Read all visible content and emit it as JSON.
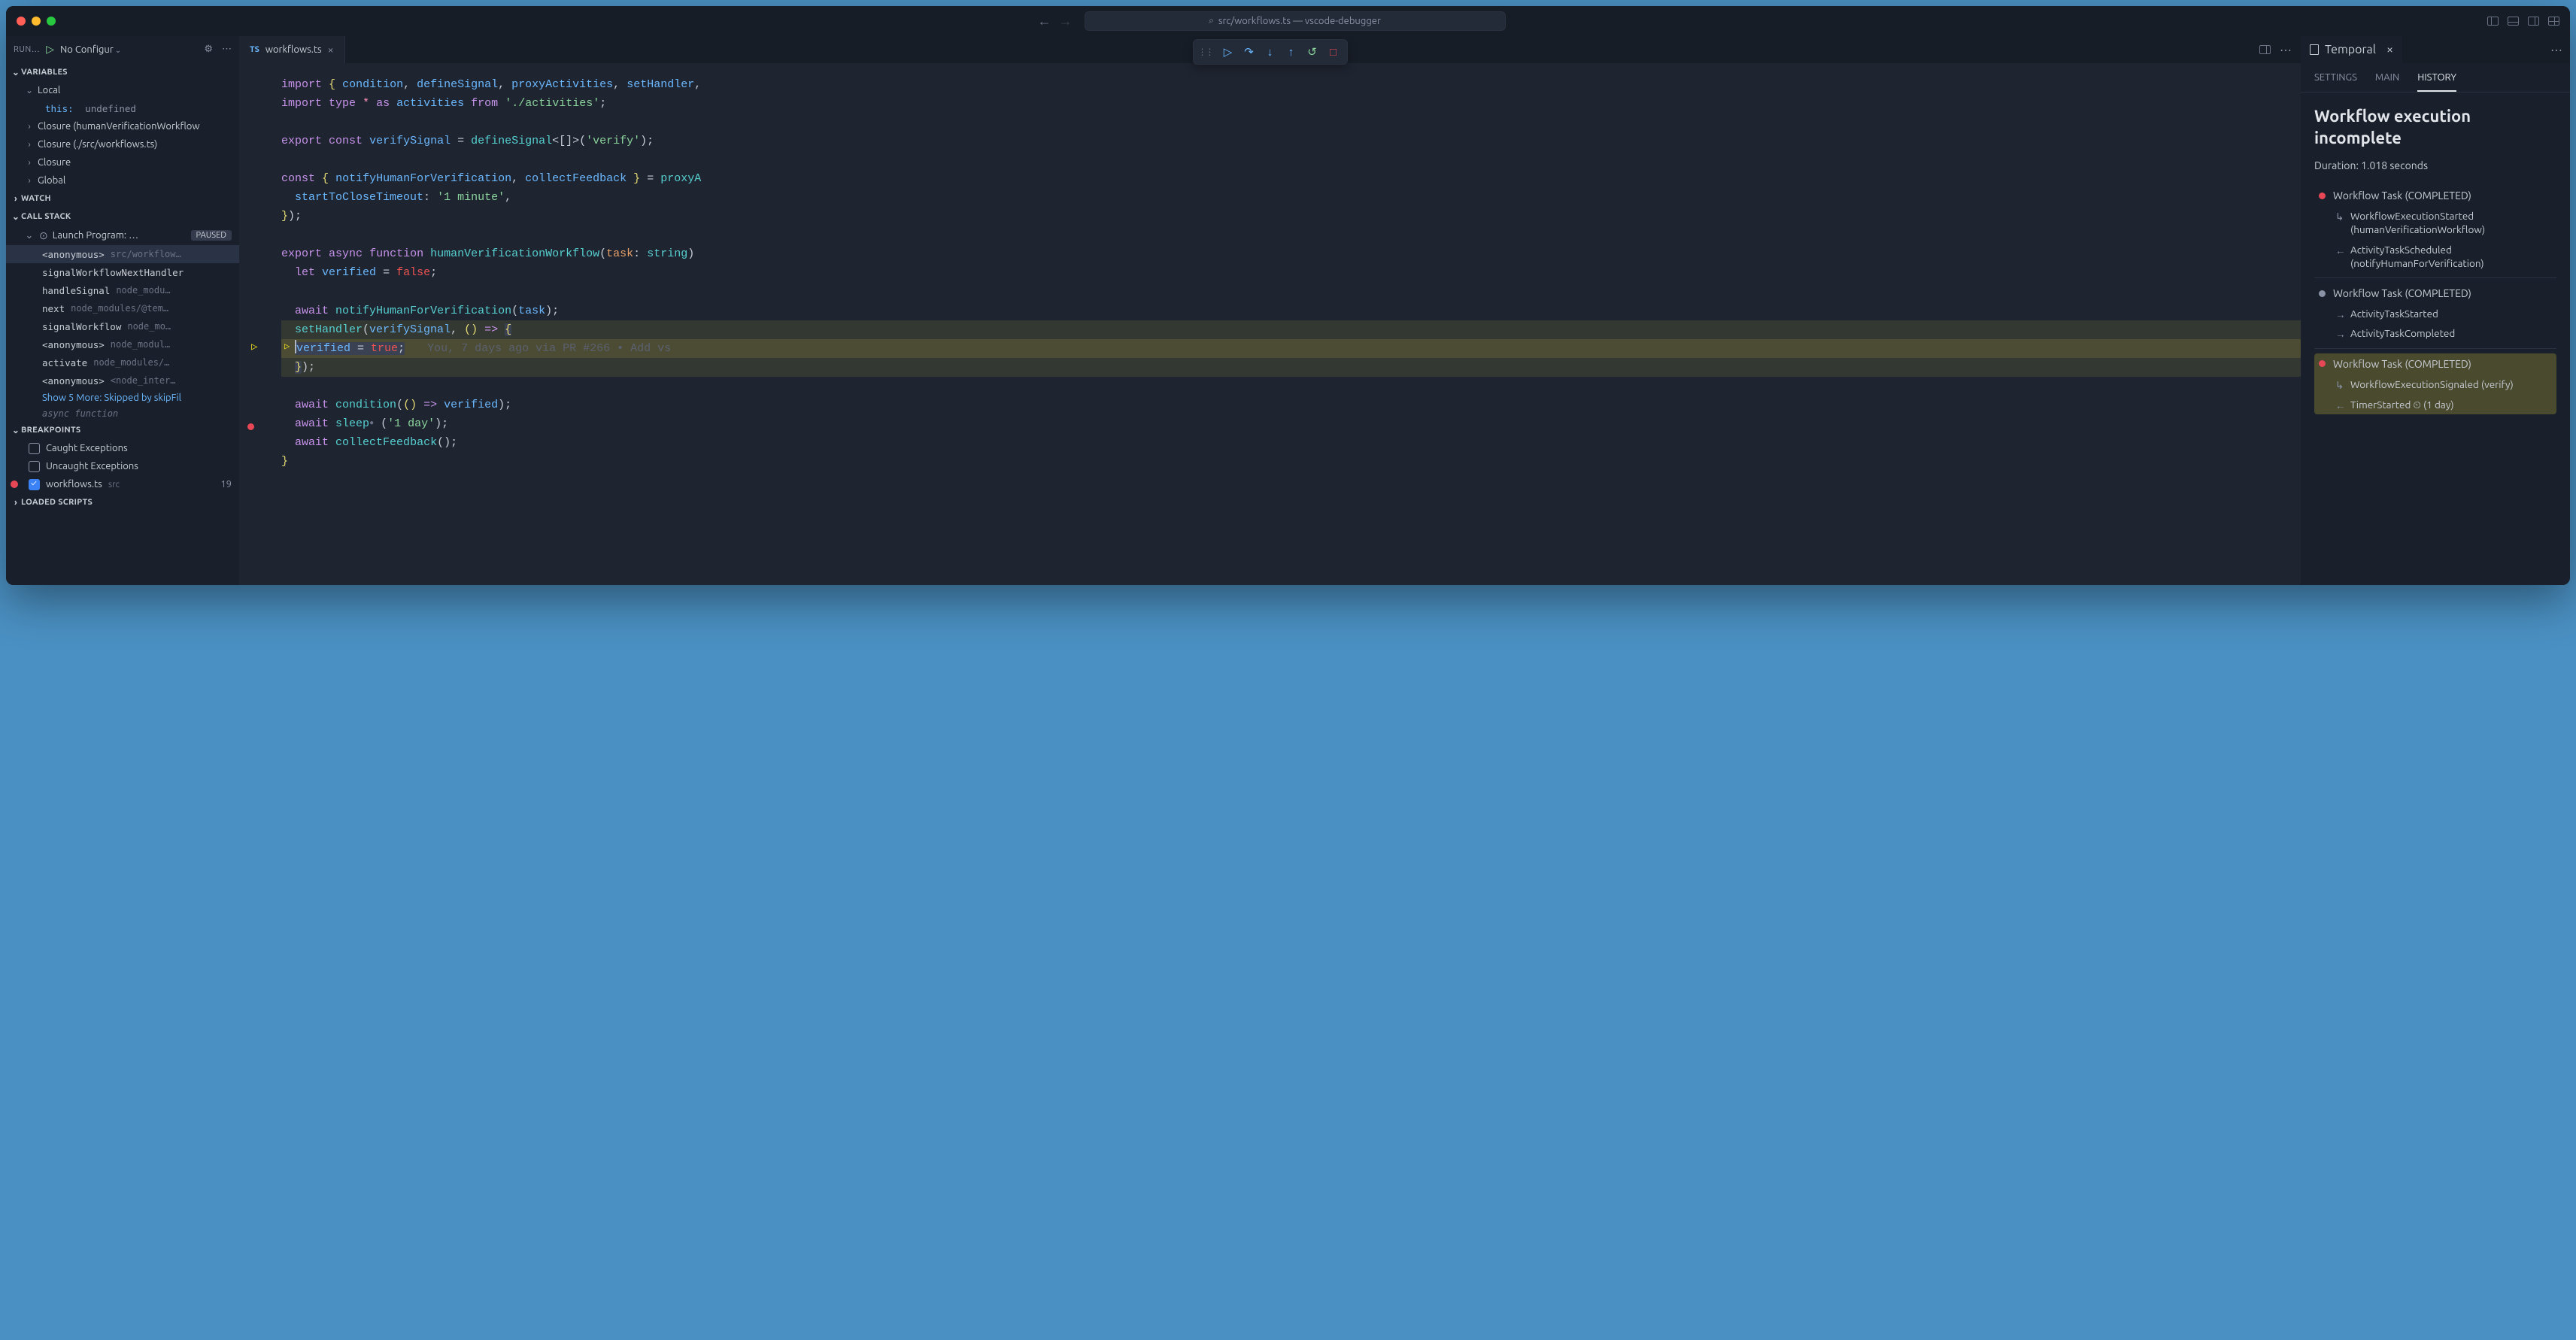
{
  "titlebar": {
    "search_text": "src/workflows.ts — vscode-debugger"
  },
  "debug_header": {
    "run_label": "RUN…",
    "config": "No Configur"
  },
  "sections": {
    "variables": "VARIABLES",
    "watch": "WATCH",
    "call_stack": "CALL STACK",
    "breakpoints": "BREAKPOINTS",
    "loaded_scripts": "LOADED SCRIPTS"
  },
  "variables": {
    "local": "Local",
    "this_key": "this:",
    "this_val": "undefined",
    "closure1": "Closure (humanVerificationWorkflow",
    "closure2": "Closure (./src/workflows.ts)",
    "closure3": "Closure",
    "global": "Global"
  },
  "call_stack": {
    "launch": "Launch Program: …",
    "badge": "PAUSED",
    "frames": [
      {
        "fn": "<anonymous>",
        "path": "src/workflow…"
      },
      {
        "fn": "signalWorkflowNextHandler",
        "path": ""
      },
      {
        "fn": "handleSignal",
        "path": "node_modu…"
      },
      {
        "fn": "next",
        "path": "node_modules/@tem…"
      },
      {
        "fn": "signalWorkflow",
        "path": "node_mo…"
      },
      {
        "fn": "<anonymous>",
        "path": "node_modul…"
      },
      {
        "fn": "activate",
        "path": "node_modules/…"
      },
      {
        "fn": "<anonymous>",
        "path": "<node_inter…"
      }
    ],
    "more": "Show 5 More: Skipped by skipFil",
    "async": "async function"
  },
  "breakpoints": {
    "caught": "Caught Exceptions",
    "uncaught": "Uncaught Exceptions",
    "file": "workflows.ts",
    "src": "src",
    "line": "19"
  },
  "editor": {
    "tab_label": "workflows.ts",
    "blame": "You, 7 days ago via PR #266 • Add vs",
    "line1_imports": [
      "condition",
      "defineSignal",
      "proxyActivities",
      "setHandler"
    ],
    "line2_alias": "activities",
    "line2_from": "'./activities'",
    "verifySignal": "verifySignal",
    "verify_str": "'verify'",
    "destructure": [
      "notifyHumanForVerification",
      "collectFeedback"
    ],
    "timeout_key": "startToCloseTimeout",
    "timeout_val": "'1 minute'",
    "fn_name": "humanVerificationWorkflow",
    "param": "task",
    "param_type": "string",
    "verified": "verified",
    "false": "false",
    "true": "true",
    "sleep_val": "'1 day'"
  },
  "right_panel": {
    "tab": "Temporal",
    "subtabs": [
      "SETTINGS",
      "MAIN",
      "HISTORY"
    ],
    "heading": "Workflow execution incomplete",
    "duration": "Duration: 1.018 seconds",
    "groups": [
      {
        "dot": "red",
        "label": "Workflow Task (COMPLETED)",
        "events": [
          {
            "dir": "down",
            "text": "WorkflowExecutionStarted (humanVerificationWorkflow)"
          },
          {
            "dir": "left",
            "text": "ActivityTaskScheduled (notifyHumanForVerification)"
          }
        ]
      },
      {
        "dot": "gray",
        "label": "Workflow Task (COMPLETED)",
        "events": [
          {
            "dir": "right",
            "text": "ActivityTaskStarted"
          },
          {
            "dir": "right",
            "text": "ActivityTaskCompleted"
          }
        ]
      },
      {
        "dot": "red",
        "label": "Workflow Task (COMPLETED)",
        "highlighted": true,
        "events": [
          {
            "dir": "down",
            "text": "WorkflowExecutionSignaled (verify)"
          },
          {
            "dir": "left",
            "text": "TimerStarted ⏲ (1 day)"
          }
        ]
      }
    ]
  }
}
